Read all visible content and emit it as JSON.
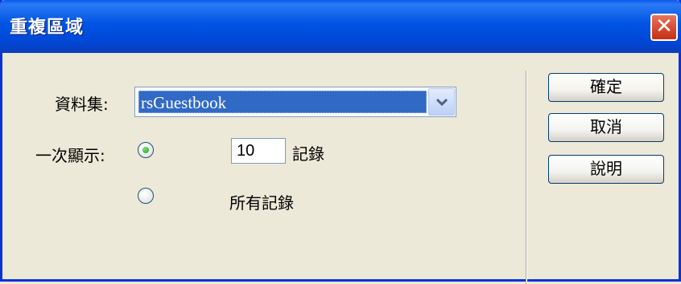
{
  "window": {
    "title": "重複區域",
    "close_label": "✕"
  },
  "form": {
    "dataset_label": "資料集:",
    "dataset_value": "rsGuestbook",
    "show_label": "一次顯示:",
    "count_value": "10",
    "records_suffix": "記錄",
    "all_records_label": "所有記錄",
    "selected_option": "count"
  },
  "buttons": {
    "ok": "確定",
    "cancel": "取消",
    "help": "說明"
  }
}
